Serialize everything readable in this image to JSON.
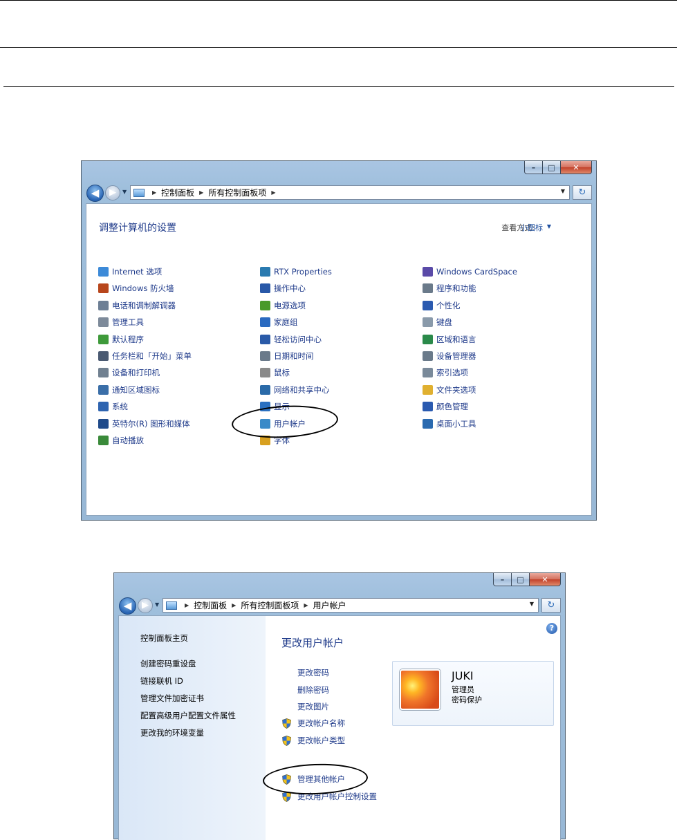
{
  "window1": {
    "breadcrumb": [
      "控制面板",
      "所有控制面板项"
    ],
    "heading": "调整计算机的设置",
    "view_label": "查看方式:",
    "view_value": "小图标",
    "columns": [
      [
        {
          "label": "Internet 选项",
          "icon": "internet-options-icon",
          "color": "#3c8ad8"
        },
        {
          "label": "Windows 防火墙",
          "icon": "firewall-icon",
          "color": "#b8461c"
        },
        {
          "label": "电话和调制解调器",
          "icon": "phone-modem-icon",
          "color": "#6d7f95"
        },
        {
          "label": "管理工具",
          "icon": "admin-tools-icon",
          "color": "#7d8a9a"
        },
        {
          "label": "默认程序",
          "icon": "default-programs-icon",
          "color": "#3e9a3a"
        },
        {
          "label": "任务栏和「开始」菜单",
          "icon": "taskbar-icon",
          "color": "#4a5a72"
        },
        {
          "label": "设备和打印机",
          "icon": "printer-icon",
          "color": "#708090"
        },
        {
          "label": "通知区域图标",
          "icon": "notification-icon",
          "color": "#3a6ea8"
        },
        {
          "label": "系统",
          "icon": "system-icon",
          "color": "#2e64b0"
        },
        {
          "label": "英特尔(R) 图形和媒体",
          "icon": "intel-graphics-icon",
          "color": "#1f4a8a"
        },
        {
          "label": "自动播放",
          "icon": "autoplay-icon",
          "color": "#3a8a3a"
        }
      ],
      [
        {
          "label": "RTX Properties",
          "icon": "rtx-icon",
          "color": "#2a7ab0"
        },
        {
          "label": "操作中心",
          "icon": "action-center-icon",
          "color": "#2858a8"
        },
        {
          "label": "电源选项",
          "icon": "power-icon",
          "color": "#4a9a2a"
        },
        {
          "label": "家庭组",
          "icon": "homegroup-icon",
          "color": "#2a6ac0"
        },
        {
          "label": "轻松访问中心",
          "icon": "ease-of-access-icon",
          "color": "#2a5aa8"
        },
        {
          "label": "日期和时间",
          "icon": "date-time-icon",
          "color": "#6a7a8a"
        },
        {
          "label": "鼠标",
          "icon": "mouse-icon",
          "color": "#8a8a8a"
        },
        {
          "label": "网络和共享中心",
          "icon": "network-icon",
          "color": "#2a6aa8"
        },
        {
          "label": "显示",
          "icon": "display-icon",
          "color": "#2a70c0"
        },
        {
          "label": "用户帐户",
          "icon": "user-accounts-icon",
          "color": "#3a8ac8"
        },
        {
          "label": "字体",
          "icon": "fonts-icon",
          "color": "#d8a020"
        }
      ],
      [
        {
          "label": "Windows CardSpace",
          "icon": "cardspace-icon",
          "color": "#5a4aa8"
        },
        {
          "label": "程序和功能",
          "icon": "programs-icon",
          "color": "#6a7a8a"
        },
        {
          "label": "个性化",
          "icon": "personalization-icon",
          "color": "#2a5ab0"
        },
        {
          "label": "键盘",
          "icon": "keyboard-icon",
          "color": "#8a9aaa"
        },
        {
          "label": "区域和语言",
          "icon": "region-language-icon",
          "color": "#2a8a4a"
        },
        {
          "label": "设备管理器",
          "icon": "device-manager-icon",
          "color": "#6a7a8a"
        },
        {
          "label": "索引选项",
          "icon": "indexing-icon",
          "color": "#7a8a9a"
        },
        {
          "label": "文件夹选项",
          "icon": "folder-options-icon",
          "color": "#e0b030"
        },
        {
          "label": "颜色管理",
          "icon": "color-management-icon",
          "color": "#2a5ab0"
        },
        {
          "label": "桌面小工具",
          "icon": "gadgets-icon",
          "color": "#2a6ab0"
        }
      ]
    ]
  },
  "window2": {
    "breadcrumb": [
      "控制面板",
      "所有控制面板项",
      "用户帐户"
    ],
    "sidebar": {
      "home": "控制面板主页",
      "links": [
        "创建密码重设盘",
        "链接联机 ID",
        "管理文件加密证书",
        "配置高级用户配置文件属性",
        "更改我的环境变量"
      ]
    },
    "heading": "更改用户帐户",
    "tasks": [
      {
        "label": "更改密码",
        "shield": false
      },
      {
        "label": "删除密码",
        "shield": false
      },
      {
        "label": "更改图片",
        "shield": false
      },
      {
        "label": "更改帐户名称",
        "shield": true
      },
      {
        "label": "更改帐户类型",
        "shield": true
      }
    ],
    "other_tasks": [
      {
        "label": "管理其他帐户",
        "shield": true
      },
      {
        "label": "更改用户帐户控制设置",
        "shield": true
      }
    ],
    "user": {
      "name": "JUKI",
      "role": "管理员",
      "status": "密码保护"
    }
  },
  "colors": {
    "link": "#1e3a8a",
    "sidebar_bg": "#dae7f7"
  }
}
